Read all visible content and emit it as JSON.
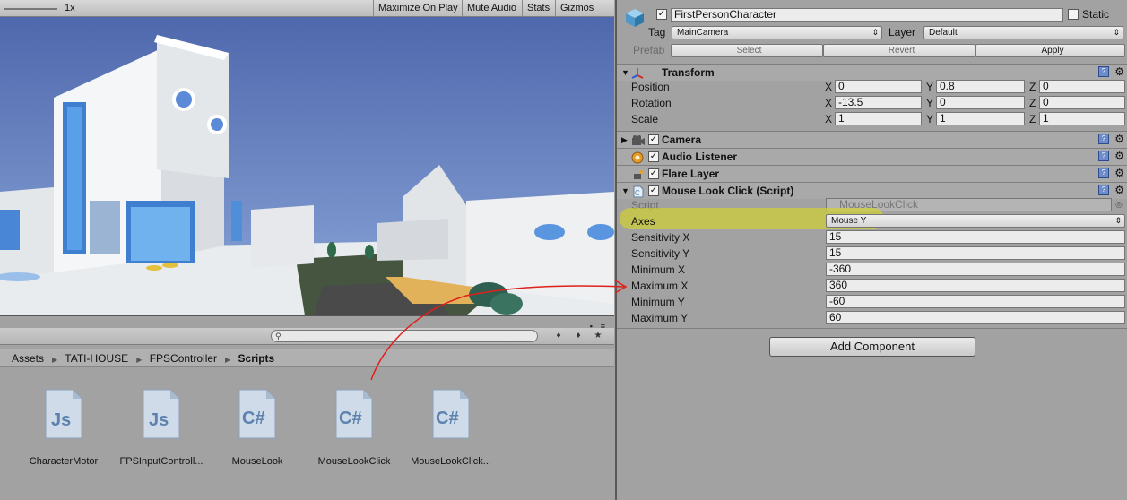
{
  "game_toolbar": {
    "scale_label": "1x",
    "maximize_on_play": "Maximize On Play",
    "mute_audio": "Mute Audio",
    "stats": "Stats",
    "gizmos": "Gizmos"
  },
  "project": {
    "breadcrumb": [
      "Assets",
      "TATI-HOUSE",
      "FPSController",
      "Scripts"
    ],
    "assets": [
      {
        "name": "CharacterMotor",
        "kind": "Js"
      },
      {
        "name": "FPSInputControll...",
        "kind": "Js"
      },
      {
        "name": "MouseLook",
        "kind": "C#"
      },
      {
        "name": "MouseLookClick",
        "kind": "C#"
      },
      {
        "name": "MouseLookClick...",
        "kind": "C#"
      }
    ]
  },
  "inspector": {
    "object_name": "FirstPersonCharacter",
    "static_label": "Static",
    "tag_label": "Tag",
    "tag_value": "MainCamera",
    "layer_label": "Layer",
    "layer_value": "Default",
    "prefab_label": "Prefab",
    "select_label": "Select",
    "revert_label": "Revert",
    "apply_label": "Apply",
    "transform": {
      "title": "Transform",
      "position_label": "Position",
      "rotation_label": "Rotation",
      "scale_label": "Scale",
      "x_label": "X",
      "y_label": "Y",
      "z_label": "Z",
      "position": [
        "0",
        "0.8",
        "0"
      ],
      "rotation": [
        "-13.5",
        "0",
        "0"
      ],
      "scale": [
        "1",
        "1",
        "1"
      ]
    },
    "camera_title": "Camera",
    "audio_listener_title": "Audio Listener",
    "flare_layer_title": "Flare Layer",
    "mouse_look": {
      "title": "Mouse Look Click (Script)",
      "script_label": "Script",
      "script_value": "MouseLookClick",
      "axes_label": "Axes",
      "axes_value": "Mouse Y",
      "sensitivity_x_label": "Sensitivity X",
      "sensitivity_x": "15",
      "sensitivity_y_label": "Sensitivity Y",
      "sensitivity_y": "15",
      "minimum_x_label": "Minimum X",
      "minimum_x": "-360",
      "maximum_x_label": "Maximum X",
      "maximum_x": "360",
      "minimum_y_label": "Minimum Y",
      "minimum_y": "-60",
      "maximum_y_label": "Maximum Y",
      "maximum_y": "60"
    },
    "add_component_label": "Add Component"
  },
  "colors": {
    "annotation_arrow": "#e0201a",
    "axes_highlight": "#d6d62a",
    "sky": "#5a74b8",
    "panel_bg": "#a2a2a2"
  }
}
